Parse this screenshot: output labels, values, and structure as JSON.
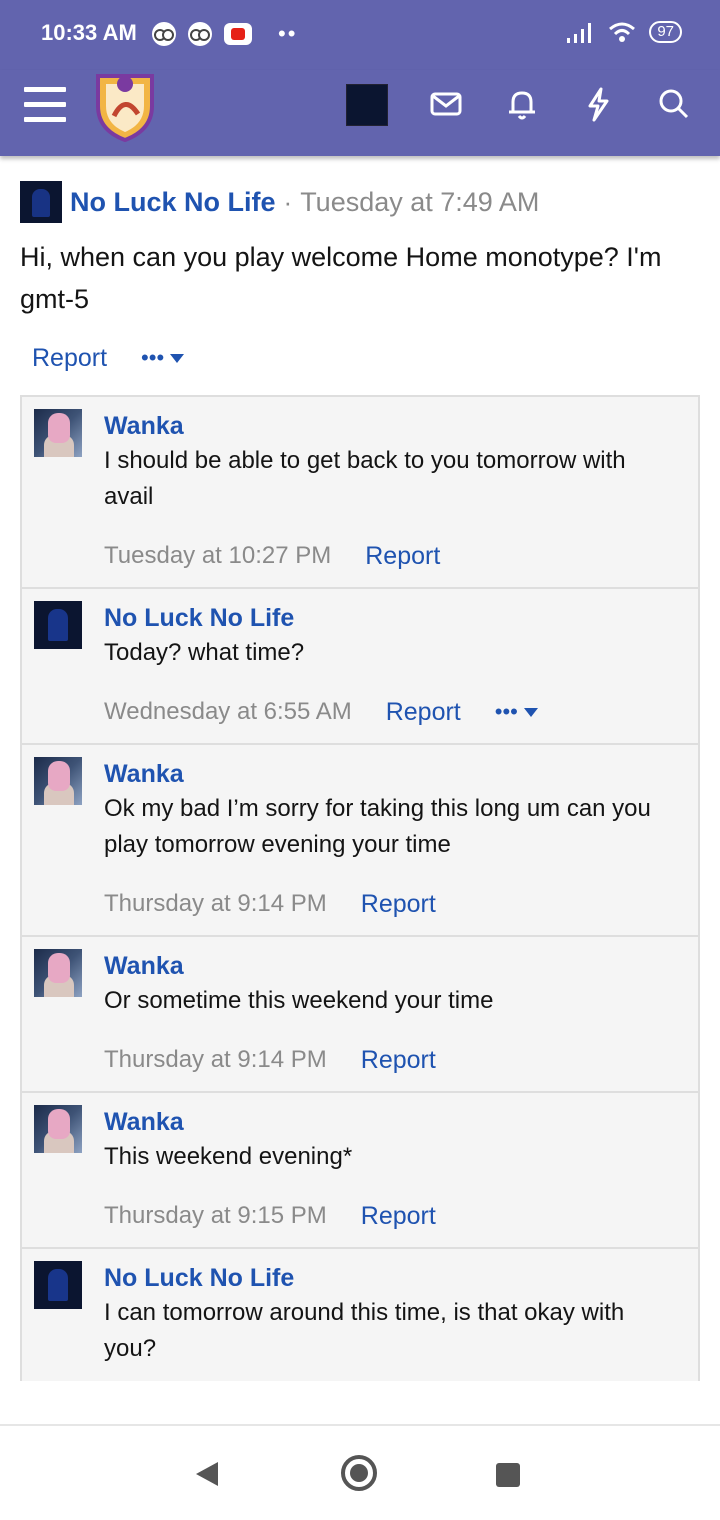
{
  "status_bar": {
    "time": "10:33 AM",
    "battery": "97",
    "dots": "••"
  },
  "app_header": {
    "icons": [
      "menu-icon",
      "logo-icon",
      "user-avatar",
      "mail-icon",
      "bell-icon",
      "bolt-icon",
      "search-icon"
    ]
  },
  "post": {
    "author": "No Luck No Life",
    "separator": "·",
    "time": "Tuesday at 7:49 AM",
    "body": "Hi, when can you play welcome Home monotype? I'm gmt-5",
    "report": "Report",
    "more": "•••"
  },
  "comments": [
    {
      "author": "Wanka",
      "body": "I should be able to get back to you tomorrow with avail",
      "time": "Tuesday at 10:27 PM",
      "report": "Report"
    },
    {
      "author": "No Luck No Life",
      "body": "Today? what time?",
      "time": "Wednesday at 6:55 AM",
      "report": "Report",
      "more": "•••"
    },
    {
      "author": "Wanka",
      "body": "Ok my bad I’m sorry for taking this long um can you play tomorrow evening your time",
      "time": "Thursday at 9:14 PM",
      "report": "Report"
    },
    {
      "author": "Wanka",
      "body": "Or sometime this weekend your time",
      "time": "Thursday at 9:14 PM",
      "report": "Report"
    },
    {
      "author": "Wanka",
      "body": "This weekend evening*",
      "time": "Thursday at 9:15 PM",
      "report": "Report"
    },
    {
      "author": "No Luck No Life",
      "body": "I can tomorrow around this time, is that okay with you?"
    }
  ],
  "colors": {
    "header_bg": "#6264ae",
    "link": "#1f53b0",
    "meta_gray": "#8a8a8a",
    "comment_bg": "#f5f5f5"
  }
}
